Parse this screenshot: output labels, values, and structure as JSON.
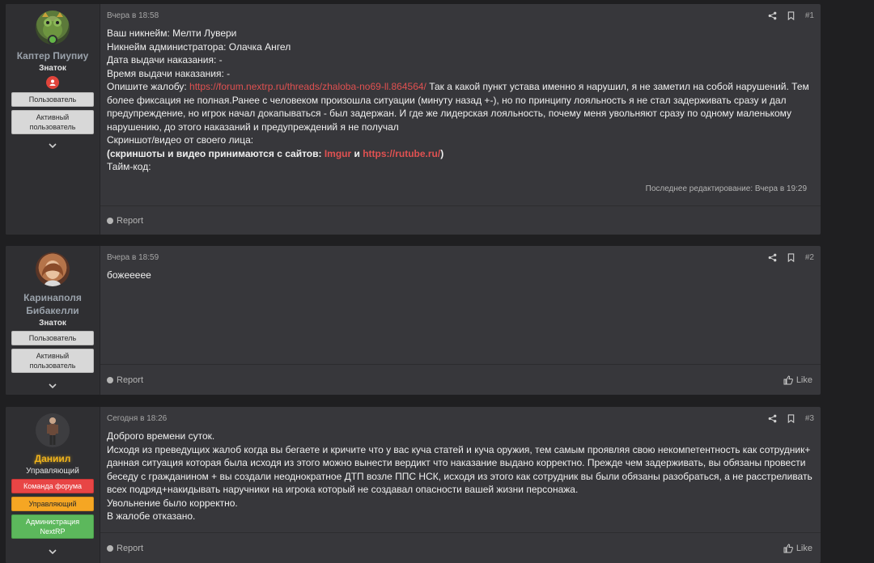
{
  "posts": [
    {
      "author": "Каптер Пиупиу",
      "title": "Знаток",
      "badges": [
        "Пользователь",
        "Активный пользователь"
      ],
      "date": "Вчера в 18:58",
      "number": "#1",
      "lines": {
        "l1": "Ваш никнейм: Мелти Лувери",
        "l2": "Никнейм администратора: Олачка Ангел",
        "l3": "Дата выдачи наказания: -",
        "l4": "Время выдачи наказания: -",
        "l5_prefix": "Опишите жалобу: ",
        "l5_link": "https://forum.nextrp.ru/threads/zhaloba-no69-ll.864564/",
        "l5_rest": " Так а какой пункт устава именно я нарушил, я не заметил на собой нарушений. Тем более фиксация не полная.Ранее с человеком произошла ситуации (минуту назад +-), но по принципу лояльность я не стал задерживать сразу и дал предупреждение, но игрок начал докапываться - был задержан. И где же лидерская лояльность, почему меня увольняют сразу по одному маленькому нарушению, до этого наказаний и предупреждений я не получал",
        "l6": "Скриншот/видео от своего лица:",
        "l7_prefix": "(скриншоты и видео принимаются с сайтов: ",
        "l7_link1": "Imgur",
        "l7_mid": " и ",
        "l7_link2": "https://rutube.ru/",
        "l7_suffix": ")",
        "l8": "Тайм-код:"
      },
      "edited": "Последнее редактирование: Вчера в 19:29",
      "report": "Report"
    },
    {
      "author": "Каринаполя Бибакелли",
      "title": "Знаток",
      "badges": [
        "Пользователь",
        "Активный пользователь"
      ],
      "date": "Вчера в 18:59",
      "number": "#2",
      "text": "божеееее",
      "report": "Report",
      "like": "Like"
    },
    {
      "author": "Даниил",
      "title": "Управляющий",
      "badges": [
        "Команда форума",
        "Управляющий",
        "Администрация NextRP"
      ],
      "date": "Сегодня в 18:26",
      "number": "#3",
      "lines": {
        "l1": "Доброго времени суток.",
        "l2": "Исходя из преведущих жалоб когда вы бегаете и кричите что у вас куча статей и куча оружия, тем самым проявляя свою некомпетентность как сотрудник+ данная ситуация которая была исходя из этого можно вынести вердикт что наказание выдано корректно. Прежде чем задерживать, вы обязаны провести беседу с гражданином + вы создали неоднократное ДТП возле ППС НСК, исходя из этого как сотрудник вы были обязаны разобраться, а не расстреливать всех подряд+накидывать наручники на игрока который не создавал опасности вашей жизни персонажа.",
        "l3": "Увольнение было корректно.",
        "l4": "В жалобе отказано."
      },
      "report": "Report",
      "like": "Like"
    }
  ],
  "colors": {
    "link": "#e05151",
    "gold_name": "#f1b41c",
    "online": "#63b648"
  },
  "icons": [
    "share-icon",
    "bookmark-icon",
    "chevron-down-icon",
    "report-icon",
    "thumbs-up-icon",
    "role-icon"
  ]
}
